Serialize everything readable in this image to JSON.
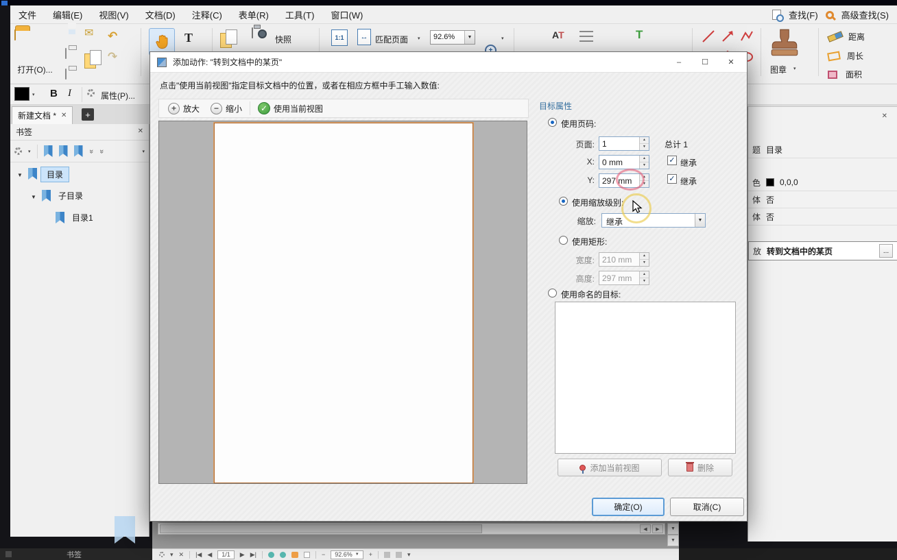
{
  "colors": {
    "accent_blue": "#1766c2",
    "check_green": "#3f9e3f",
    "page_border": "#b06a30",
    "swatch_black": "#000000"
  },
  "menubar": {
    "items": [
      {
        "label": "文件"
      },
      {
        "label": "编辑(E)"
      },
      {
        "label": "视图(V)"
      },
      {
        "label": "文档(D)"
      },
      {
        "label": "注释(C)"
      },
      {
        "label": "表单(R)"
      },
      {
        "label": "工具(T)"
      },
      {
        "label": "窗口(W)"
      }
    ],
    "find_label": "查找(F)",
    "advanced_find_label": "高级查找(S)"
  },
  "toolbar": {
    "open_label": "打开(O)...",
    "snapshot_label": "快照",
    "one_to_one_label": "1:1",
    "fit_page_label": "匹配页面",
    "zoom_value": "92.6%",
    "stamp_label": "图章",
    "distance_label": "距离",
    "perimeter_label": "周长",
    "area_label": "面积",
    "bold_label": "B",
    "italic_label": "I",
    "properties_label": "属性(P)..."
  },
  "tabbar": {
    "document_tab_label": "新建文档 *"
  },
  "bookmarks_panel": {
    "title": "书签",
    "items": [
      {
        "label": "目录"
      },
      {
        "label": "子目录"
      },
      {
        "label": "目录1"
      }
    ]
  },
  "dialog": {
    "title": "添加动作: \"转到文档中的某页\"",
    "instruction": "点击\"使用当前视图\"指定目标文档中的位置，或者在相应方框中手工输入数值:",
    "zoom_in_label": "放大",
    "zoom_out_label": "缩小",
    "use_current_view_label": "使用当前视图",
    "target": {
      "section_title": "目标属性",
      "use_page_label": "使用页码:",
      "page_label": "页面:",
      "page_value": "1",
      "page_total": "总计 1",
      "x_label": "X:",
      "x_value": "0 mm",
      "x_inherit_label": "继承",
      "y_label": "Y:",
      "y_value": "297 mm",
      "y_inherit_label": "继承",
      "use_zoom_label": "使用缩放级别:",
      "zoom_label": "缩放:",
      "zoom_value": "继承",
      "use_rect_label": "使用矩形:",
      "width_label": "宽度:",
      "width_value": "210 mm",
      "height_label": "高度:",
      "height_value": "297 mm",
      "use_named_label": "使用命名的目标:"
    },
    "add_current_view_label": "添加当前视图",
    "delete_label": "删除",
    "ok_label": "确定(O)",
    "cancel_label": "取消(C)"
  },
  "right_panel": {
    "rows": [
      {
        "label": "题",
        "value": "目录"
      },
      {
        "label": "色",
        "value": "0,0,0"
      },
      {
        "label": "体",
        "value": "否"
      },
      {
        "label": "体",
        "value": "否"
      },
      {
        "label": "放",
        "value": "转到文档中的某页"
      }
    ],
    "more_label": "..."
  },
  "bottom_bar": {
    "bookmarks_tab_label": "书签",
    "page_info": "1/1",
    "zoom_value": "92.6%"
  }
}
